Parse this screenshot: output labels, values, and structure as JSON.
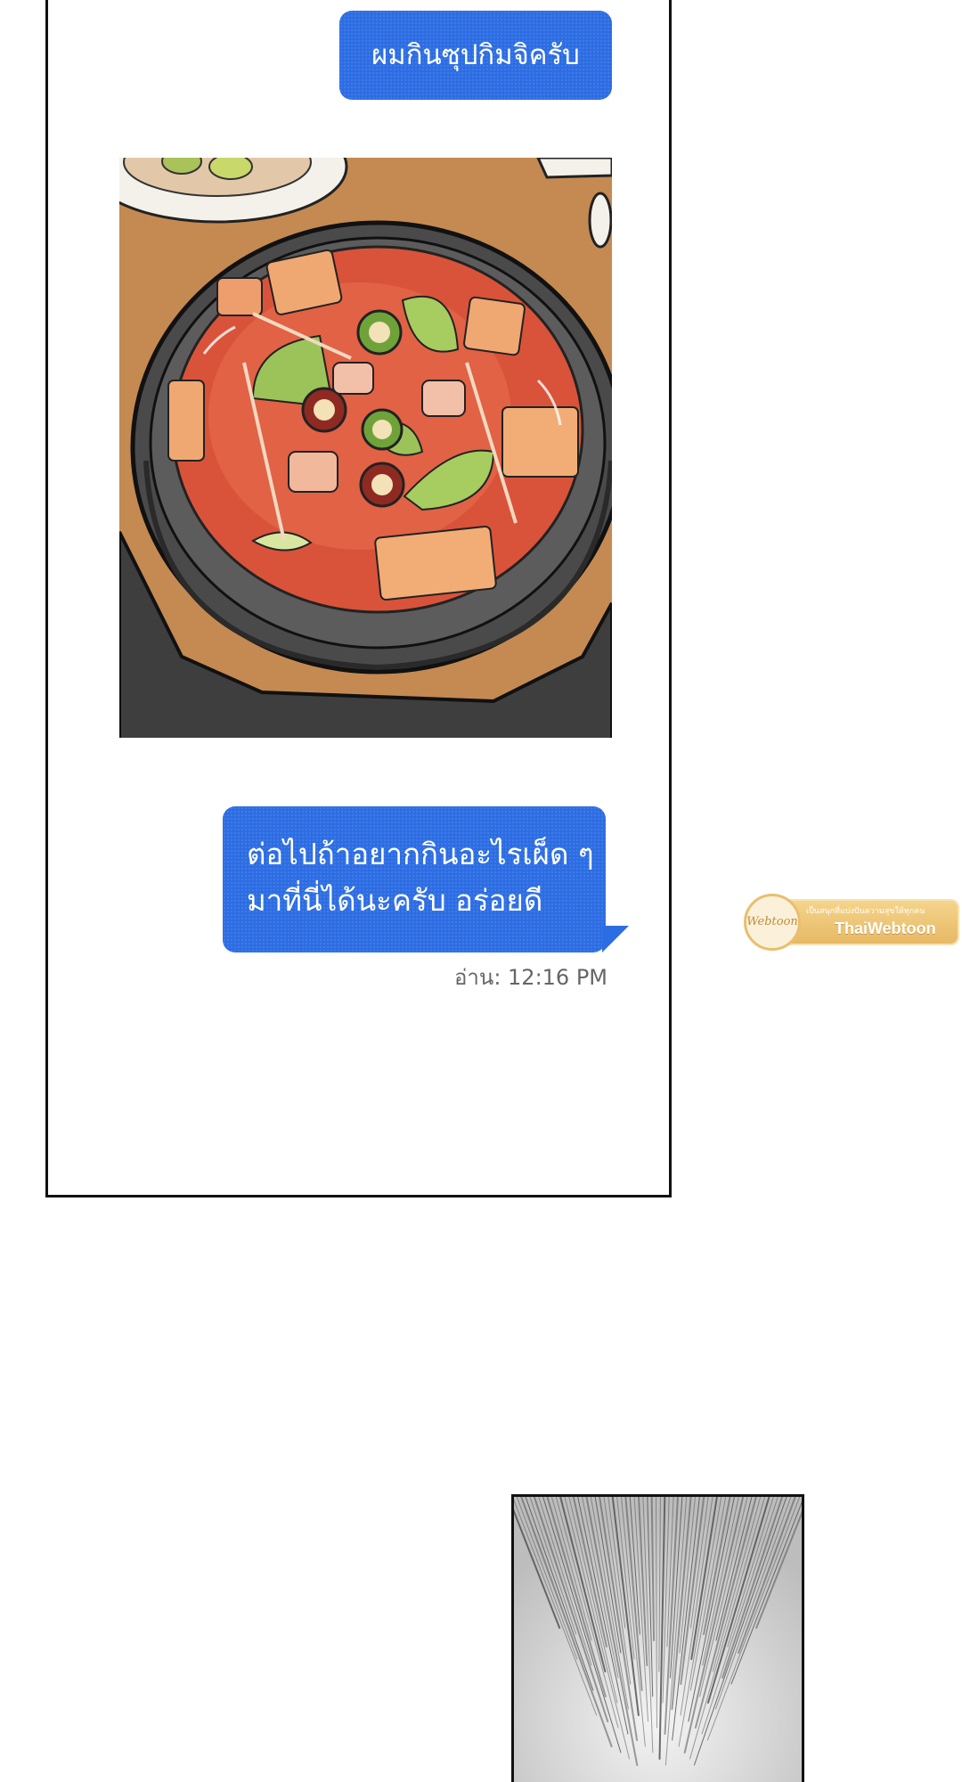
{
  "chat": {
    "message_1": "ผมกินซุปกิมจิครับ",
    "message_2_lines": [
      "ต่อไปถ้าอยากกินอะไรเผ็ด ๆ",
      "มาที่นี่ได้นะครับ อร่อยดี"
    ],
    "read_receipt": "อ่าน: 12:16 PM"
  },
  "photo": {
    "subject": "kimchi-jjigae-in-stone-pot"
  },
  "watermark": {
    "tagline": "เป็นสนุกที่แบ่งปันความสุขให้ทุกคน",
    "brand": "ThaiWebtoon",
    "logo": "Webtoon"
  },
  "colors": {
    "bubble_blue": "#2d6de3",
    "panel_border": "#111111",
    "receipt_gray": "#666666",
    "watermark_gold": "#e6b863"
  }
}
